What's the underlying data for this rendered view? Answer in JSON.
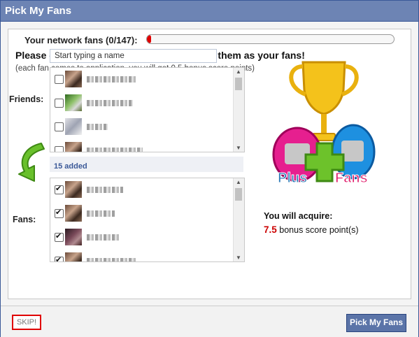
{
  "dialog": {
    "title": "Pick My Fans"
  },
  "network": {
    "label": "Your network fans (0/147):",
    "progress_fraction": 0.0
  },
  "headline": "Please choose some of your friends to add them as your fans!",
  "subline": "(each fan comes to application, you will got 0.5 bonus score points)",
  "search": {
    "placeholder": "Start typing a name"
  },
  "friends": {
    "label": "Friends:",
    "rows": [
      {
        "checked": false,
        "avatar": "avatar"
      },
      {
        "checked": false,
        "avatar": "avatar"
      },
      {
        "checked": false,
        "avatar": "avatar"
      },
      {
        "checked": false,
        "avatar": "avatar"
      }
    ]
  },
  "added": {
    "text": "15 added"
  },
  "fans": {
    "label": "Fans:",
    "rows": [
      {
        "checked": true,
        "avatar": "avatar"
      },
      {
        "checked": true,
        "avatar": "avatar"
      },
      {
        "checked": true,
        "avatar": "avatar"
      },
      {
        "checked": true,
        "avatar": "avatar"
      }
    ]
  },
  "logo": {
    "text_plus": "Plus",
    "text_fans": "Fans",
    "icon": "trophy-icon"
  },
  "acquire": {
    "label": "You will acquire:",
    "points": "7.5",
    "suffix": "bonus score point(s)"
  },
  "buttons": {
    "skip": "SKIP!",
    "pick": "Pick My Fans"
  },
  "colors": {
    "titlebar": "#6d84b4",
    "accent": "#3b5998",
    "progress": "#e00000",
    "highlight": "#e00000"
  }
}
